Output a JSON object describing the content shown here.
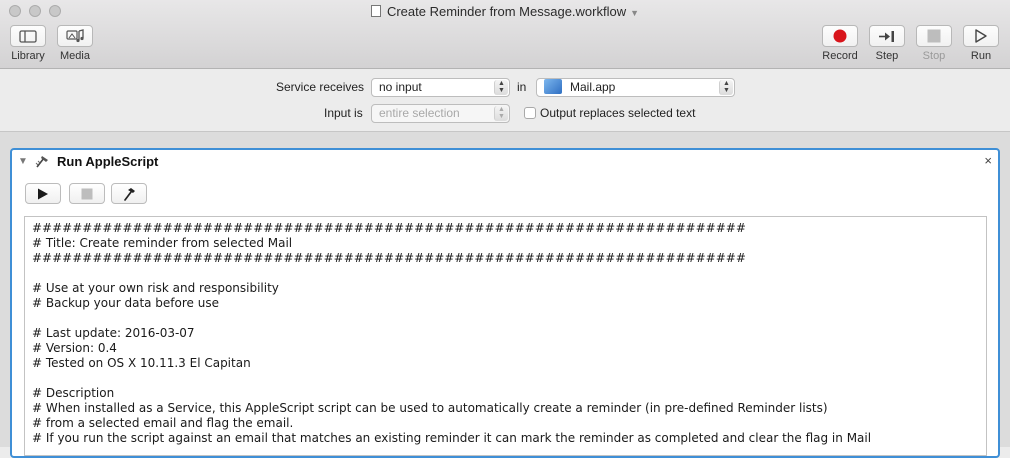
{
  "window": {
    "title": "Create Reminder from Message.workflow"
  },
  "toolbar": {
    "left": [
      {
        "label": "Library",
        "icon": "library-icon"
      },
      {
        "label": "Media",
        "icon": "media-icon"
      }
    ],
    "right": [
      {
        "label": "Record",
        "icon": "record-icon",
        "enabled": true
      },
      {
        "label": "Step",
        "icon": "step-icon",
        "enabled": true
      },
      {
        "label": "Stop",
        "icon": "stop-icon",
        "enabled": false
      },
      {
        "label": "Run",
        "icon": "run-icon",
        "enabled": true
      }
    ]
  },
  "service": {
    "receives_label": "Service receives",
    "receives_value": "no input",
    "in_label": "in",
    "app_value": "Mail.app",
    "input_is_label": "Input is",
    "input_is_value": "entire selection",
    "output_replaces_label": "Output replaces selected text",
    "output_replaces_checked": false
  },
  "action": {
    "title": "Run AppleScript",
    "close_symbol": "×",
    "script_lines": [
      "#######################################################################",
      "# Title: Create reminder from selected Mail",
      "#######################################################################",
      "",
      "# Use at your own risk and responsibility",
      "# Backup your data before use",
      "",
      "# Last update: 2016-03-07",
      "# Version: 0.4",
      "# Tested on OS X 10.11.3 El Capitan",
      "",
      "# Description",
      "# When installed as a Service, this AppleScript script can be used to automatically create a reminder (in pre-defined Reminder lists)",
      "# from a selected email and flag the email.",
      "# If you run the script against an email that matches an existing reminder it can mark the reminder as completed and clear the flag in Mail"
    ]
  },
  "colors": {
    "accent": "#3f8fd6",
    "record": "#d8141a"
  }
}
